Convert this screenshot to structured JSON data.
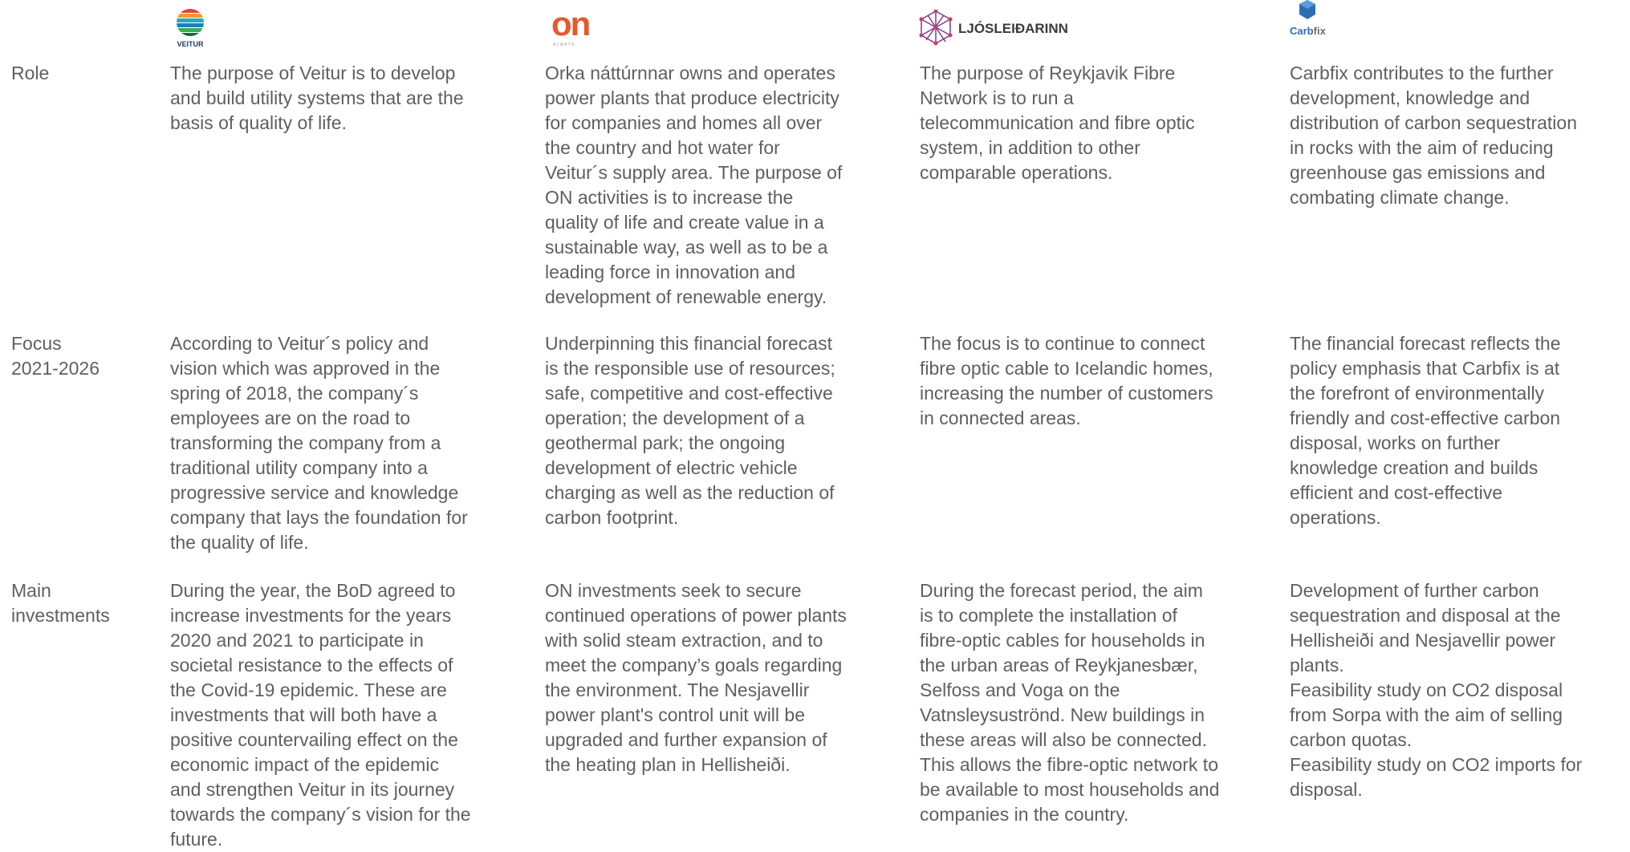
{
  "logos": {
    "veitur": {
      "name": "VEITUR"
    },
    "on": {
      "name": "on",
      "tagline": "A L W A Y S"
    },
    "ljosleidarinn": {
      "name": "LJÓSLEIÐARINN"
    },
    "carbfix": {
      "name_part1": "Carb",
      "name_part2": "fix"
    }
  },
  "rows": [
    {
      "label": "Role",
      "cells": [
        "The purpose of Veitur is to develop\nand build utility systems that are the\nbasis of quality of life.",
        "Orka náttúrnnar owns and operates\npower plants that produce electricity\nfor companies and homes all over\nthe country and hot water for\nVeitur´s supply area. The purpose of\nON activities is to increase the\nquality of life and create value in a\nsustainable way, as well as to be a\nleading force in innovation and\ndevelopment of renewable energy.",
        "The purpose of Reykjavik Fibre\nNetwork is to run a\ntelecommunication and fibre optic\nsystem, in addition to other\ncomparable operations.",
        "Carbfix contributes to the further\ndevelopment, knowledge and\ndistribution of carbon sequestration\nin rocks with the aim of reducing\ngreenhouse gas emissions and\ncombating climate change."
      ]
    },
    {
      "label": "Focus\n2021-2026",
      "cells": [
        "According to Veitur´s policy and\nvision which was approved in the\nspring of 2018, the company´s\nemployees are on the road to\ntransforming the company from a\ntraditional utility company into a\nprogressive service and knowledge\ncompany that lays the foundation for\nthe quality of life.",
        "Underpinning this financial forecast\nis the responsible use of resources;\nsafe, competitive and cost-effective\noperation; the development of a\ngeothermal park; the ongoing\ndevelopment of electric vehicle\ncharging as well as the reduction of\ncarbon footprint.",
        "The focus is to continue to connect\nfibre optic cable to Icelandic homes,\nincreasing the number of customers\nin connected areas.",
        "The financial forecast reflects the\npolicy emphasis that Carbfix is at\nthe forefront of environmentally\nfriendly and cost-effective carbon\ndisposal, works on further\nknowledge creation and builds\nefficient and cost-effective\noperations."
      ]
    },
    {
      "label": "Main\ninvestments",
      "cells": [
        "During the year, the BoD agreed to\nincrease investments for the years\n2020 and 2021 to participate in\nsocietal resistance to the effects of\nthe Covid-19 epidemic. These are\ninvestments that will both have a\npositive countervailing effect on the\neconomic impact of the epidemic\nand strengthen Veitur in its journey\ntowards the company´s vision for the\nfuture.",
        "ON investments seek to secure\ncontinued operations of power plants\nwith solid steam extraction, and to\nmeet the company’s goals regarding\nthe environment. The Nesjavellir\npower plant's control unit will be\nupgraded and further expansion of\nthe heating plan in Hellisheiði.",
        "During the forecast period, the aim\nis to complete the installation of\nfibre-optic cables for households in\nthe urban areas of Reykjanesbær,\nSelfoss and Voga on the\nVatnsleysuströnd. New buildings in\nthese areas will also be connected.\nThis allows the fibre-optic network to\nbe available to most households and\ncompanies in the country.",
        "Development of further carbon\nsequestration and disposal at the\nHellisheiði and Nesjavellir power\nplants.\nFeasibility study on CO2 disposal\nfrom Sorpa with the aim of selling\ncarbon quotas.\nFeasibility study on CO2 imports for\ndisposal."
      ]
    }
  ]
}
